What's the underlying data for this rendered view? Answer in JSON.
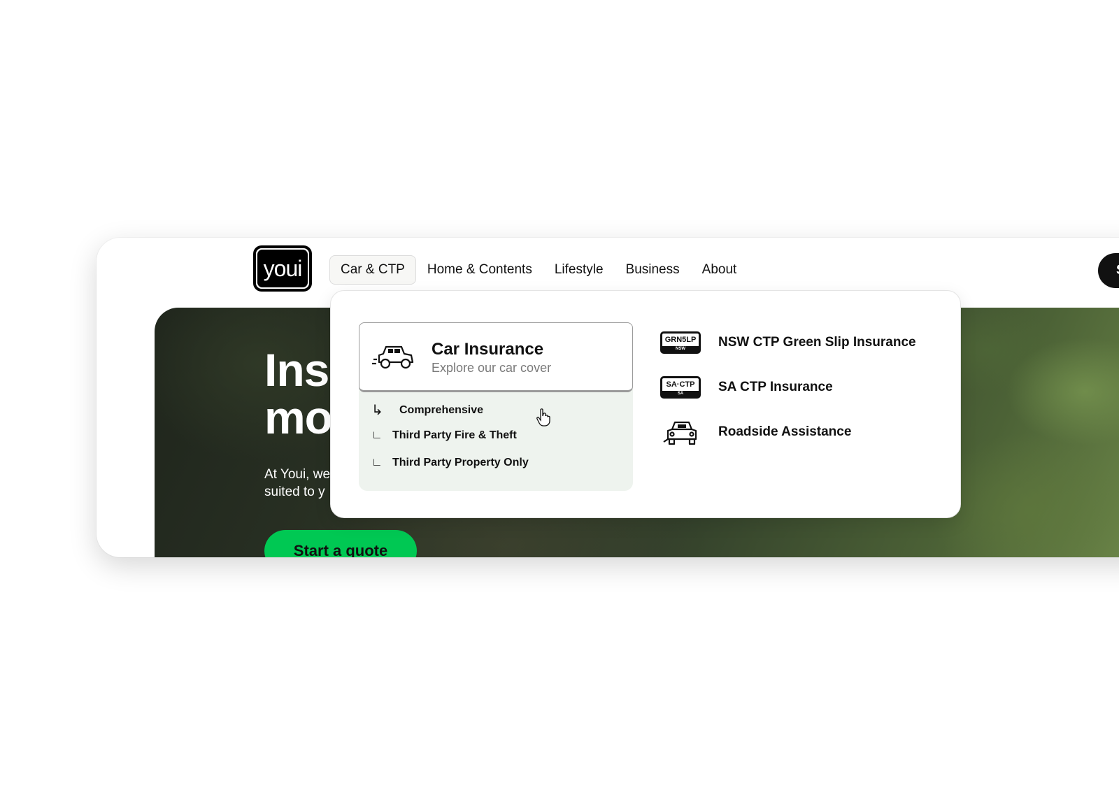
{
  "brand": {
    "logo_text": "youi"
  },
  "nav": {
    "items": [
      {
        "label": "Car & CTP",
        "active": true
      },
      {
        "label": "Home & Contents",
        "active": false
      },
      {
        "label": "Lifestyle",
        "active": false
      },
      {
        "label": "Business",
        "active": false
      },
      {
        "label": "About",
        "active": false
      }
    ],
    "cta_partial": "S"
  },
  "hero": {
    "title_line1": "Ins",
    "title_line2": "mo",
    "text_line1": "At Youi, we",
    "text_line2": "suited to y",
    "cta_label": "Start a quote"
  },
  "mega_menu": {
    "primary": {
      "icon": "car-icon",
      "title": "Car Insurance",
      "subtitle": "Explore our car cover"
    },
    "sub_items": [
      {
        "label": "Comprehensive",
        "glyph": "↳"
      },
      {
        "label": "Third Party Fire & Theft",
        "glyph": "∟"
      },
      {
        "label": "Third Party Property Only",
        "glyph": "∟"
      }
    ],
    "secondary": [
      {
        "label": "NSW CTP Green Slip Insurance",
        "icon": "nsw-plate-icon",
        "plate_text": "GRN5LP",
        "plate_strip": "NSW"
      },
      {
        "label": "SA CTP Insurance",
        "icon": "sa-plate-icon",
        "plate_text": "SA·CTP",
        "plate_strip": "SA"
      },
      {
        "label": "Roadside Assistance",
        "icon": "roadside-car-icon"
      }
    ]
  },
  "colors": {
    "accent_green": "#00c853",
    "sublist_bg": "#eef3ee",
    "text": "#111111"
  }
}
